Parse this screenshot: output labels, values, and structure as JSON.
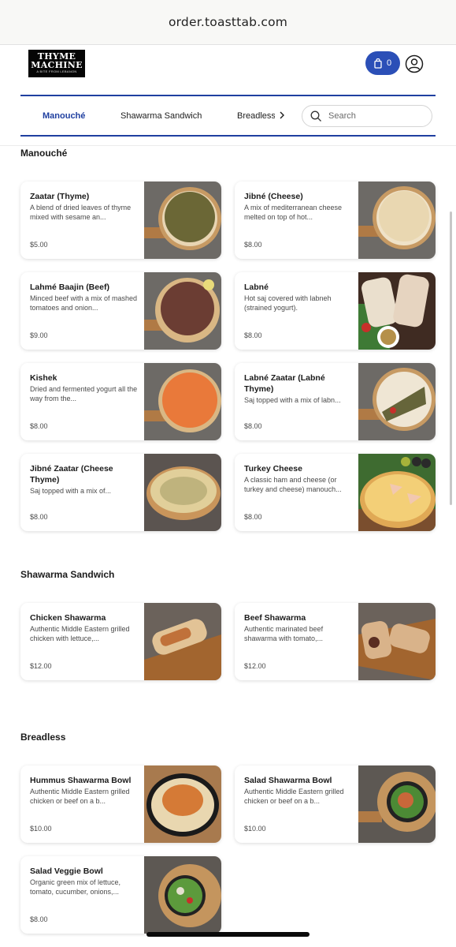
{
  "browser": {
    "url": "order.toasttab.com"
  },
  "header": {
    "logo": {
      "line1": "THYME",
      "line2": "MACHINE",
      "tagline": "A BITE FROM LEBANON"
    },
    "cart_count": "0",
    "icons": {
      "cart": "shopping-bag-icon",
      "user": "user-account-icon"
    }
  },
  "nav": {
    "tabs": [
      "Manouché",
      "Shawarma Sandwich",
      "Breadless"
    ],
    "active_tab": "Manouché",
    "search_placeholder": "Search"
  },
  "colors": {
    "brand_blue": "#1f3fa0",
    "cart_blue": "#2b4fb7"
  },
  "sections": [
    {
      "title": "Manouché",
      "items": [
        {
          "name": "Zaatar (Thyme)",
          "desc": "A blend of dried leaves of thyme mixed with sesame an...",
          "price": "$5.00"
        },
        {
          "name": "Jibné (Cheese)",
          "desc": "A mix of mediterranean cheese melted on top of hot...",
          "price": "$8.00"
        },
        {
          "name": "Lahmé Baajin (Beef)",
          "desc": "Minced beef with a mix of mashed tomatoes and onion...",
          "price": "$9.00"
        },
        {
          "name": "Labné",
          "desc": "Hot saj covered with labneh (strained yogurt).",
          "price": "$8.00"
        },
        {
          "name": "Kishek",
          "desc": "Dried and fermented yogurt all the way from the...",
          "price": "$8.00"
        },
        {
          "name": "Labné Zaatar (Labné Thyme)",
          "desc": "Saj topped with a mix of labn...",
          "price": "$8.00"
        },
        {
          "name": "Jibné Zaatar (Cheese Thyme)",
          "desc": "Saj topped with a mix of...",
          "price": "$8.00"
        },
        {
          "name": "Turkey Cheese",
          "desc": "A classic ham and cheese (or turkey and cheese) manouch...",
          "price": "$8.00"
        }
      ]
    },
    {
      "title": "Shawarma Sandwich",
      "items": [
        {
          "name": "Chicken Shawarma",
          "desc": "Authentic Middle Eastern grilled chicken with lettuce,...",
          "price": "$12.00"
        },
        {
          "name": "Beef Shawarma",
          "desc": "Authentic marinated beef shawarma with tomato,...",
          "price": "$12.00"
        }
      ]
    },
    {
      "title": "Breadless",
      "items": [
        {
          "name": "Hummus Shawarma Bowl",
          "desc": "Authentic Middle Eastern grilled chicken or beef on a b...",
          "price": "$10.00"
        },
        {
          "name": "Salad Shawarma Bowl",
          "desc": "Authentic Middle Eastern grilled chicken or beef on a b...",
          "price": "$10.00"
        },
        {
          "name": "Salad Veggie Bowl",
          "desc": "Organic green mix of lettuce, tomato, cucumber, onions,...",
          "price": "$8.00"
        }
      ]
    }
  ]
}
